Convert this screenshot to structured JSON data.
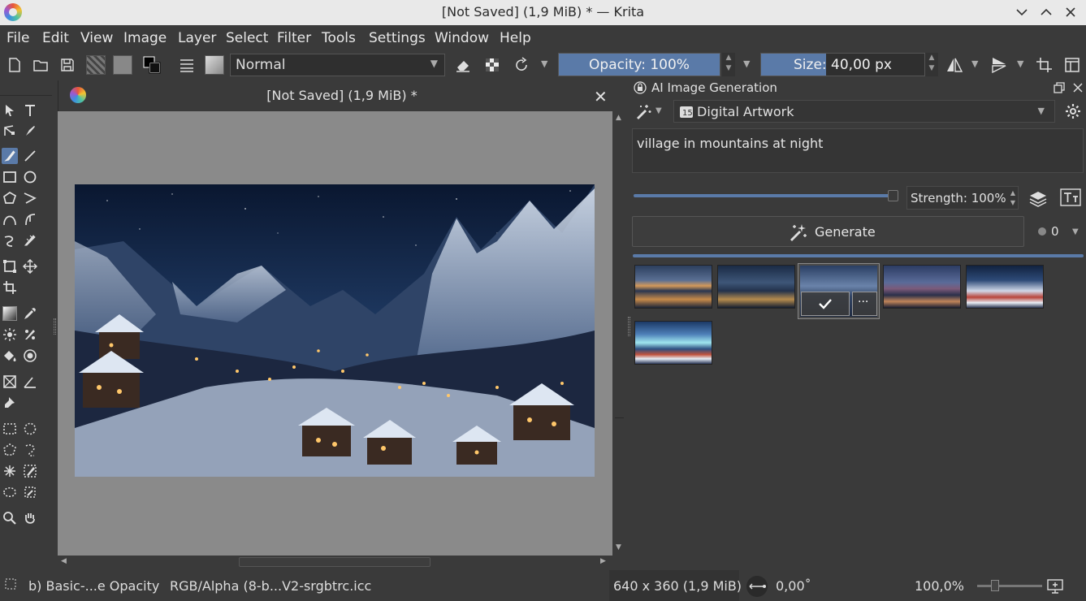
{
  "window": {
    "title": "[Not Saved] (1,9 MiB) * — Krita",
    "controls": [
      "minimize",
      "maximize",
      "close"
    ]
  },
  "menu": [
    "File",
    "Edit",
    "View",
    "Image",
    "Layer",
    "Select",
    "Filter",
    "Tools",
    "Settings",
    "Window",
    "Help"
  ],
  "toolbar": {
    "blend_mode": "Normal",
    "opacity_label": "Opacity: 100%",
    "opacity_value": 1.0,
    "size_label": "Size: 40,00 px",
    "size_fraction": 0.4
  },
  "document": {
    "title": "[Not Saved]  (1,9 MiB) *",
    "close_glyph": "✕"
  },
  "panel": {
    "title": "AI Image Generation",
    "style": "Digital Artwork",
    "prompt": "village in mountains at night",
    "strength_label": "Strength: 100%",
    "strength_value": 1.0,
    "generate_label": "Generate",
    "seed_count": "0",
    "thumbnail_count": 6,
    "selected_thumbnail": 3
  },
  "status": {
    "brush": "b) Basic-...e Opacity",
    "color_space": "RGB/Alpha (8-b...V2-srgbtrc.icc",
    "dimensions": "640 x 360 (1,9 MiB)",
    "rotation": "0,00˚",
    "zoom": "100,0%"
  },
  "colors": {
    "accent": "#5a7aa8",
    "background": "#3a3a3a",
    "canvas": "#8a8a8a",
    "titlebar": "#e9e9e9"
  }
}
